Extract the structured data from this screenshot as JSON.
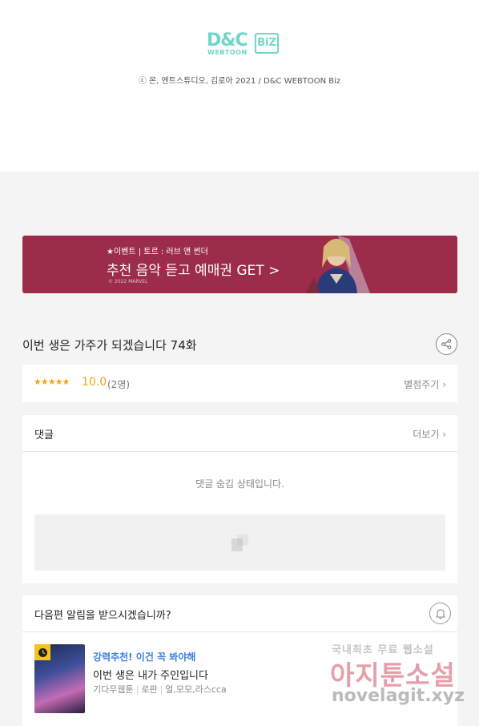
{
  "footer": {
    "logo": {
      "main": "D&C",
      "badge": "BiZ",
      "sub": "WEBTOON"
    },
    "copyright": "ⓒ 몬, 엔트스튜디오, 김로아 2021 / D&C WEBTOON Biz"
  },
  "banner": {
    "small": "★이벤트 | 토르 : 러브 앤 썬더",
    "big": "추천 음악 듣고 예매권 GET >",
    "mark": "© 2022 MARVEL"
  },
  "episode": {
    "title": "이번 생은 가주가 되겠습니다 74화",
    "share_icon": "share-icon"
  },
  "rating": {
    "stars": "★★★★★",
    "score": "10.0",
    "count": "(2명)",
    "rate_label": "별점주기 ›"
  },
  "comments": {
    "title": "댓글",
    "more_label": "더보기 ›",
    "hidden_message": "댓글 숨김 상태입니다."
  },
  "alarm": {
    "question": "다음편 알림을 받으시겠습니까?",
    "bell_icon": "bell-icon"
  },
  "recommend": {
    "tag": "강력추천! 이건 꼭 봐야해",
    "title": "이번 생은 내가 주인입니다",
    "genre": "기다무웹툰",
    "category": "로판",
    "authors": "얼,모모,라스cca"
  },
  "watermark": {
    "top": "국내최초 무료 웹소설",
    "middle": "아지툰소설",
    "bottom": "novelagit.xyz"
  },
  "colors": {
    "banner_bg": "#9b2c4a",
    "star": "#f4a21a",
    "accent_blue": "#3b7ee0",
    "logo": "#6fd6c9"
  }
}
